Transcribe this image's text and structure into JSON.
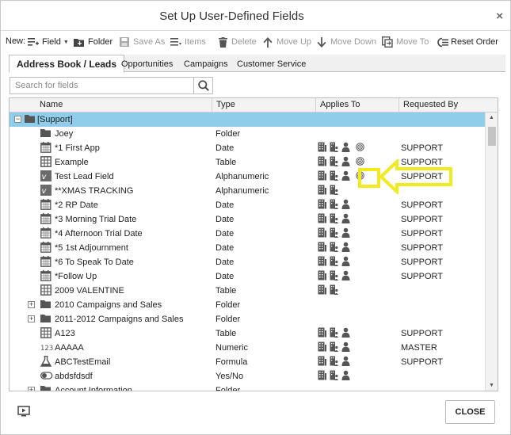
{
  "dialog": {
    "title": "Set Up User-Defined Fields",
    "close_glyph": "×"
  },
  "toolbar": {
    "new_label": "New:",
    "field_label": "Field",
    "folder_label": "Folder",
    "save_as_label": "Save As",
    "items_label": "Items",
    "delete_label": "Delete",
    "move_up_label": "Move Up",
    "move_down_label": "Move Down",
    "move_to_label": "Move To",
    "reset_order_label": "Reset Order"
  },
  "tabs": [
    {
      "label": "Address Book / Leads",
      "active": true
    },
    {
      "label": "Opportunities",
      "active": false
    },
    {
      "label": "Campaigns",
      "active": false
    },
    {
      "label": "Customer Service",
      "active": false
    }
  ],
  "search": {
    "placeholder": "Search for fields",
    "value": ""
  },
  "columns": {
    "name": "Name",
    "type": "Type",
    "applies_to": "Applies To",
    "requested_by": "Requested By"
  },
  "rows": [
    {
      "expander": "−",
      "icon": "folder-icon",
      "name": "[Support]",
      "type": "",
      "applies": [],
      "requested": "",
      "selected": true,
      "level": 0
    },
    {
      "expander": "",
      "icon": "folder-icon",
      "name": "Joey",
      "type": "Folder",
      "applies": [],
      "requested": "",
      "level": 1
    },
    {
      "expander": "",
      "icon": "calendar-icon",
      "name": "*1 First App",
      "type": "Date",
      "applies": [
        "building-icon",
        "contact-card-icon",
        "person-icon",
        "target-icon"
      ],
      "requested": "SUPPORT",
      "level": 1
    },
    {
      "expander": "",
      "icon": "table-icon",
      "name": "Example",
      "type": "Table",
      "applies": [
        "building-icon",
        "contact-card-icon",
        "person-icon",
        "target-icon"
      ],
      "requested": "SUPPORT",
      "level": 1
    },
    {
      "expander": "",
      "icon": "alphanumeric-icon",
      "name": "Test Lead Field",
      "type": "Alphanumeric",
      "applies": [
        "building-icon",
        "contact-card-icon",
        "person-icon",
        "target-icon"
      ],
      "requested": "SUPPORT",
      "level": 1
    },
    {
      "expander": "",
      "icon": "alphanumeric-icon",
      "name": "**XMAS TRACKING",
      "type": "Alphanumeric",
      "applies": [
        "building-icon",
        "contact-card-icon"
      ],
      "requested": "",
      "level": 1
    },
    {
      "expander": "",
      "icon": "calendar-icon",
      "name": "*2 RP Date",
      "type": "Date",
      "applies": [
        "building-icon",
        "contact-card-icon",
        "person-icon"
      ],
      "requested": "SUPPORT",
      "level": 1
    },
    {
      "expander": "",
      "icon": "calendar-icon",
      "name": "*3 Morning Trial Date",
      "type": "Date",
      "applies": [
        "building-icon",
        "contact-card-icon",
        "person-icon"
      ],
      "requested": "SUPPORT",
      "level": 1
    },
    {
      "expander": "",
      "icon": "calendar-icon",
      "name": "*4 Afternoon Trial Date",
      "type": "Date",
      "applies": [
        "building-icon",
        "contact-card-icon",
        "person-icon"
      ],
      "requested": "SUPPORT",
      "level": 1
    },
    {
      "expander": "",
      "icon": "calendar-icon",
      "name": "*5 1st Adjournment",
      "type": "Date",
      "applies": [
        "building-icon",
        "contact-card-icon",
        "person-icon"
      ],
      "requested": "SUPPORT",
      "level": 1
    },
    {
      "expander": "",
      "icon": "calendar-icon",
      "name": "*6 To Speak To Date",
      "type": "Date",
      "applies": [
        "building-icon",
        "contact-card-icon",
        "person-icon"
      ],
      "requested": "SUPPORT",
      "level": 1
    },
    {
      "expander": "",
      "icon": "calendar-icon",
      "name": "*Follow Up",
      "type": "Date",
      "applies": [
        "building-icon",
        "contact-card-icon",
        "person-icon"
      ],
      "requested": "SUPPORT",
      "level": 1
    },
    {
      "expander": "",
      "icon": "table-icon",
      "name": "2009 VALENTINE",
      "type": "Table",
      "applies": [
        "building-icon",
        "contact-card-icon"
      ],
      "requested": "",
      "level": 1
    },
    {
      "expander": "+",
      "icon": "folder-icon",
      "name": "2010 Campaigns and Sales",
      "type": "Folder",
      "applies": [],
      "requested": "",
      "level": 1
    },
    {
      "expander": "+",
      "icon": "folder-icon",
      "name": "2011-2012 Campaigns and Sales",
      "type": "Folder",
      "applies": [],
      "requested": "",
      "level": 1
    },
    {
      "expander": "",
      "icon": "table-icon",
      "name": "A123",
      "type": "Table",
      "applies": [
        "building-icon",
        "contact-card-icon",
        "person-icon"
      ],
      "requested": "SUPPORT",
      "level": 1
    },
    {
      "expander": "",
      "icon": "numeric-icon",
      "name": "AAAAA",
      "type": "Numeric",
      "applies": [
        "building-icon",
        "contact-card-icon",
        "person-icon"
      ],
      "requested": "MASTER",
      "level": 1
    },
    {
      "expander": "",
      "icon": "formula-icon",
      "name": "ABCTestEmail",
      "type": "Formula",
      "applies": [
        "building-icon",
        "contact-card-icon",
        "person-icon"
      ],
      "requested": "SUPPORT",
      "level": 1
    },
    {
      "expander": "",
      "icon": "toggle-icon",
      "name": "abdsfdsdf",
      "type": "Yes/No",
      "applies": [
        "building-icon",
        "contact-card-icon",
        "person-icon"
      ],
      "requested": "",
      "level": 1
    },
    {
      "expander": "+",
      "icon": "folder-icon",
      "name": "Account Information",
      "type": "Folder",
      "applies": [],
      "requested": "",
      "level": 1
    }
  ],
  "annotation": {
    "color": "#f2ea1d",
    "target_row": "Test Lead Field",
    "target_icon": "target-icon"
  },
  "footer": {
    "close_label": "CLOSE",
    "left_icon": "screen-play-icon"
  },
  "colors": {
    "selected_row": "#8fcdea",
    "annotation": "#f2ea1d"
  }
}
